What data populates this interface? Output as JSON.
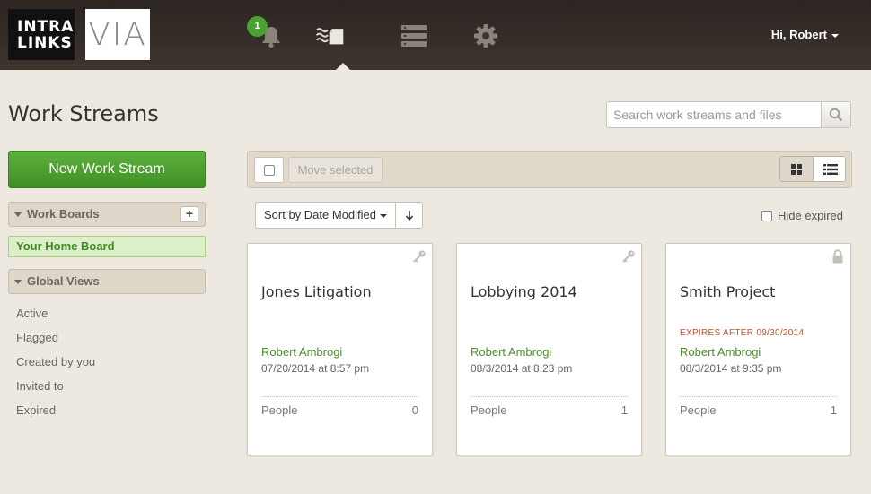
{
  "header": {
    "logo_intralinks_line1": "INTRA",
    "logo_intralinks_line2": "LINKS",
    "logo_via": "VIA",
    "notification_count": "1",
    "user_greeting": "Hi, Robert",
    "nav_icons": [
      "bell-icon",
      "workstreams-icon",
      "server-icon",
      "gear-icon"
    ]
  },
  "page": {
    "title": "Work Streams"
  },
  "search": {
    "placeholder": "Search work streams and files"
  },
  "sidebar": {
    "new_button": "New Work Stream",
    "work_boards_label": "Work Boards",
    "home_board_label": "Your Home Board",
    "global_views_label": "Global Views",
    "views": [
      "Active",
      "Flagged",
      "Created by you",
      "Invited to",
      "Expired"
    ]
  },
  "toolbar": {
    "move_selected": "Move selected"
  },
  "sort": {
    "label": "Sort by Date Modified"
  },
  "filter": {
    "hide_expired": "Hide expired"
  },
  "cards": [
    {
      "name": "Jones Litigation",
      "expires": "",
      "owner": "Robert Ambrogi",
      "date": "07/20/2014 at 8:57 pm",
      "people_label": "People",
      "people_count": "0",
      "corner_icon": "key-icon"
    },
    {
      "name": "Lobbying 2014",
      "expires": "",
      "owner": "Robert Ambrogi",
      "date": "08/3/2014 at 8:23 pm",
      "people_label": "People",
      "people_count": "1",
      "corner_icon": "key-icon"
    },
    {
      "name": "Smith Project",
      "expires": "EXPIRES AFTER 09/30/2014",
      "owner": "Robert Ambrogi",
      "date": "08/3/2014 at 9:35 pm",
      "people_label": "People",
      "people_count": "1",
      "corner_icon": "lock-icon"
    }
  ],
  "colors": {
    "accent_green": "#4aa22f",
    "topbar": "#2c2521",
    "background": "#ede9e1",
    "expires_red": "#c0522d"
  }
}
